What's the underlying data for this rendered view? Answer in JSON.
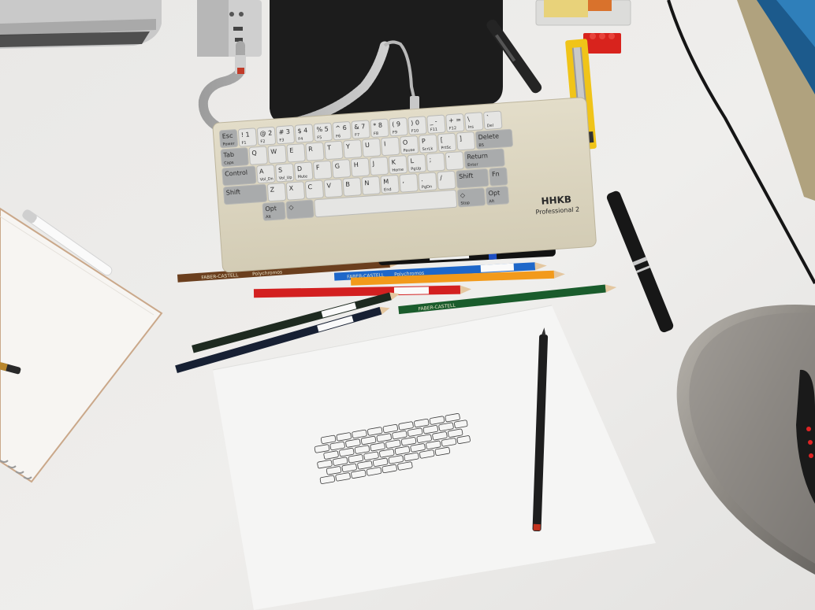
{
  "scene": {
    "desk_color": "#ecebe9",
    "paper_color": "#f4f4f3",
    "notebook_color": "#f7f5f2",
    "keyboard_case_color": "#dcd6c3",
    "mousepad_color": "#1b1b1b"
  },
  "keyboard": {
    "brand_mark": "HHKB",
    "model": "Professional 2",
    "keys": {
      "esc": "Esc",
      "esc_sub": "Power",
      "tab": "Tab",
      "caps": "Caps",
      "control": "Control",
      "shift_left": "Shift",
      "shift_right": "Shift",
      "return": "Return",
      "delete": "Delete",
      "bs": "BS",
      "alt_left": "Alt",
      "alt_right": "Alt",
      "opt_left": "Opt",
      "opt_right": "Opt",
      "fn": "Fn",
      "enter": "Enter",
      "ins": "Ins",
      "del": "Del",
      "vol_dn": "Vol_Dn",
      "vol_up": "Vol_Up",
      "mute": "Mute",
      "home": "Home",
      "end": "End",
      "pgup": "PgUp",
      "pgdn": "PgDn",
      "stop": "Stop",
      "prtsc": "PrtSc",
      "scrlk": "ScrLk",
      "pause": "Pause",
      "row1": [
        "1",
        "2",
        "3",
        "4",
        "5",
        "6",
        "7",
        "8",
        "9",
        "0",
        "-",
        "="
      ],
      "row1_sym": [
        "!",
        "@",
        "#",
        "$",
        "%",
        "^",
        "&",
        "*",
        "(",
        ")",
        "_",
        "+"
      ],
      "row1_f": [
        "F1",
        "F2",
        "F3",
        "F4",
        "F5",
        "F6",
        "F7",
        "F8",
        "F9",
        "F10",
        "F11",
        "F12"
      ],
      "row2": [
        "Q",
        "W",
        "E",
        "R",
        "T",
        "Y",
        "U",
        "I",
        "O",
        "P",
        "[",
        "]"
      ],
      "row3": [
        "A",
        "S",
        "D",
        "F",
        "G",
        "H",
        "J",
        "K",
        "L",
        ";",
        "'"
      ],
      "row4": [
        "Z",
        "X",
        "C",
        "V",
        "B",
        "N",
        "M",
        ",",
        ".",
        "/"
      ]
    }
  },
  "pencils": {
    "faber_castell": "FABER-CASTELL",
    "polychromos": "Polychromos"
  }
}
